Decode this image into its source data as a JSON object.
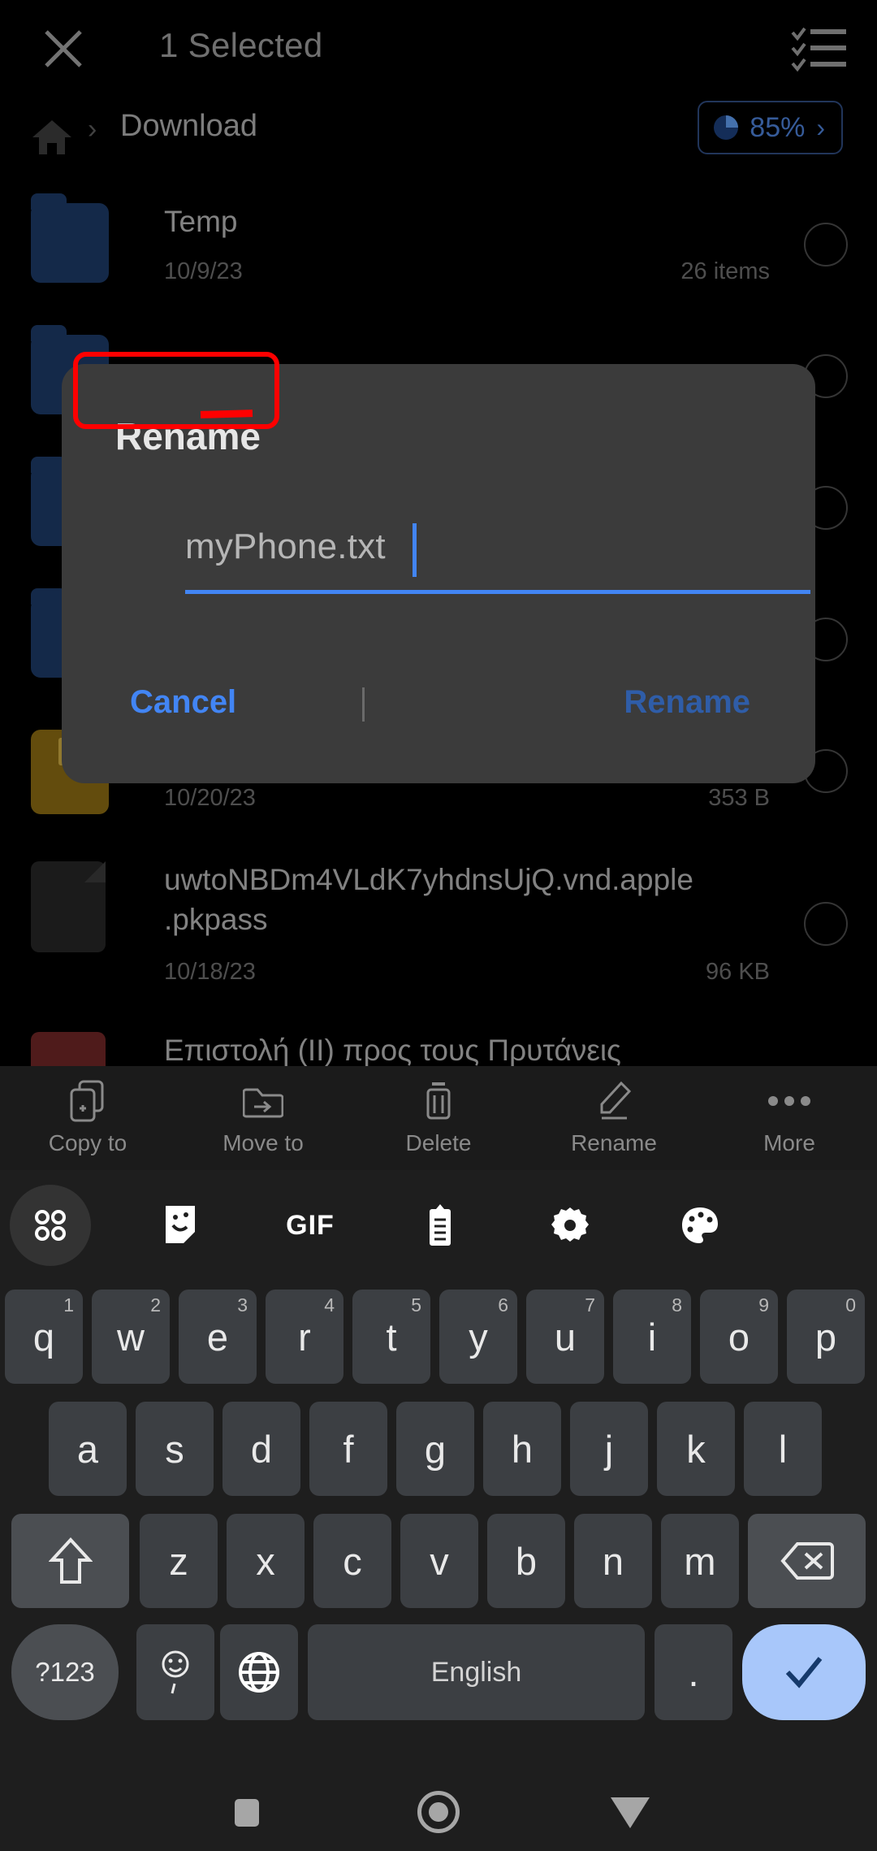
{
  "appbar": {
    "close_icon": "close-icon",
    "title": "1 Selected",
    "select_all_icon": "select-all-checklist-icon"
  },
  "breadcrumb": {
    "home_icon": "home-icon",
    "separator": "›",
    "current": "Download",
    "storage_chip": {
      "pie_icon": "pie-chart-icon",
      "percent": "85%",
      "chevron": "›",
      "border_color": "#2e4a7d",
      "text_color": "#4b7fd4"
    }
  },
  "file_list": {
    "rows": [
      {
        "type": "folder",
        "name": "Temp",
        "date": "10/9/23",
        "meta": "26 items",
        "icon": "folder-icon"
      },
      {
        "type": "folder",
        "name": "",
        "date": "",
        "meta": "",
        "icon": "folder-icon"
      },
      {
        "type": "folder",
        "name": "",
        "date": "",
        "meta": "",
        "icon": "folder-icon"
      },
      {
        "type": "folder",
        "name": "",
        "date": "",
        "meta": "",
        "icon": "folder-icon"
      },
      {
        "type": "zip",
        "name": "",
        "date": "10/20/23",
        "meta": "353 B",
        "icon": "archive-icon"
      },
      {
        "type": "doc",
        "name": "uwtoNBDm4VLdK7yhdnsUjQ.vnd.apple .pkpass",
        "date": "10/18/23",
        "meta": "96 KB",
        "icon": "file-icon"
      },
      {
        "type": "pdf",
        "name": "Επιστολή (II) προς τους Πρυτάνεις",
        "date": "",
        "meta": "",
        "icon": "pdf-icon"
      }
    ]
  },
  "dialog": {
    "title": "Rename",
    "input_value": "myPhone.txt",
    "cancel_label": "Cancel",
    "confirm_label": "Rename",
    "accent_color": "#4285f4",
    "confirm_color": "#2f5da8",
    "background": "#3b3b3b"
  },
  "annotation": {
    "box_color": "#ff0000",
    "underline_color": "#ff0000"
  },
  "action_bar": {
    "items": [
      {
        "label": "Copy to",
        "icon": "copy-to-icon"
      },
      {
        "label": "Move to",
        "icon": "move-to-icon"
      },
      {
        "label": "Delete",
        "icon": "trash-icon"
      },
      {
        "label": "Rename",
        "icon": "pencil-icon"
      },
      {
        "label": "More",
        "icon": "more-dots-icon"
      }
    ]
  },
  "keyboard": {
    "toolbar": [
      {
        "icon": "apps-grid-icon",
        "active": true
      },
      {
        "icon": "sticker-icon",
        "active": false
      },
      {
        "icon": "gif-icon",
        "label": "GIF",
        "active": false
      },
      {
        "icon": "clipboard-icon",
        "active": false
      },
      {
        "icon": "gear-icon",
        "active": false
      },
      {
        "icon": "palette-icon",
        "active": false
      }
    ],
    "row1": [
      {
        "key": "q",
        "sup": "1"
      },
      {
        "key": "w",
        "sup": "2"
      },
      {
        "key": "e",
        "sup": "3"
      },
      {
        "key": "r",
        "sup": "4"
      },
      {
        "key": "t",
        "sup": "5"
      },
      {
        "key": "y",
        "sup": "6"
      },
      {
        "key": "u",
        "sup": "7"
      },
      {
        "key": "i",
        "sup": "8"
      },
      {
        "key": "o",
        "sup": "9"
      },
      {
        "key": "p",
        "sup": "0"
      }
    ],
    "row2": [
      {
        "key": "a"
      },
      {
        "key": "s"
      },
      {
        "key": "d"
      },
      {
        "key": "f"
      },
      {
        "key": "g"
      },
      {
        "key": "h"
      },
      {
        "key": "j"
      },
      {
        "key": "k"
      },
      {
        "key": "l"
      }
    ],
    "row3": [
      {
        "key": "z"
      },
      {
        "key": "x"
      },
      {
        "key": "c"
      },
      {
        "key": "v"
      },
      {
        "key": "b"
      },
      {
        "key": "n"
      },
      {
        "key": "m"
      }
    ],
    "shift_icon": "shift-arrow-icon",
    "backspace_icon": "backspace-icon",
    "symbols_label": "?123",
    "emoji_icon": "emoji-comma-icon",
    "globe_icon": "globe-language-icon",
    "space_label": "English",
    "period_label": ".",
    "enter_icon": "checkmark-enter-icon",
    "enter_bg": "#a8c7fa"
  },
  "navbar": {
    "recents_icon": "recents-square-icon",
    "home_icon": "home-circle-icon",
    "back_icon": "back-triangle-icon"
  }
}
